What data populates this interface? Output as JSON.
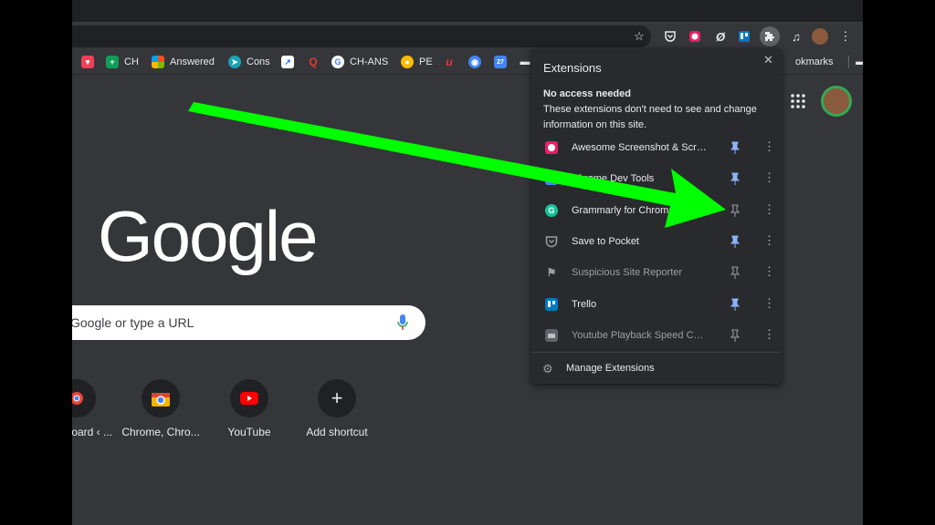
{
  "bookmarks": {
    "items": [
      {
        "label": "",
        "icon": "pocket-icon",
        "color": "#ef4056"
      },
      {
        "label": "CH",
        "icon": "sheets-icon",
        "color": "#0f9d58"
      },
      {
        "label": "Answered",
        "icon": "microsoft-icon",
        "color": "#f25022"
      },
      {
        "label": "Cons",
        "icon": "send-icon",
        "color": "#1aa3b8"
      },
      {
        "label": "",
        "icon": "bookmark-app-icon",
        "color": "#ffffff"
      },
      {
        "label": "",
        "icon": "q-icon",
        "color": "#e53935"
      },
      {
        "label": "CH-ANS",
        "icon": "google-icon",
        "color": "#ffffff"
      },
      {
        "label": "PE",
        "icon": "badge-icon",
        "color": "#fbbc04"
      },
      {
        "label": "",
        "icon": "u-icon",
        "color": "#e53935"
      },
      {
        "label": "",
        "icon": "chrome-icon",
        "color": "#4285f4"
      },
      {
        "label": "",
        "icon": "calendar-icon",
        "color": "#4285f4"
      },
      {
        "label": "",
        "icon": "folder-icon",
        "color": "#e8eaed"
      }
    ],
    "other_label": "okmarks"
  },
  "ntp": {
    "logo": "Google",
    "search_placeholder": "Google or type a URL",
    "shortcuts": [
      {
        "label": "oard ‹ ...",
        "icon": "chrome-shortcut-icon"
      },
      {
        "label": "Chrome, Chro...",
        "icon": "chrome-store-icon"
      },
      {
        "label": "YouTube",
        "icon": "youtube-icon"
      },
      {
        "label": "Add shortcut",
        "icon": "plus-icon"
      }
    ]
  },
  "extensions_popup": {
    "title": "Extensions",
    "heading": "No access needed",
    "description": "These extensions don't need to see and change information on this site.",
    "items": [
      {
        "name": "Awesome Screenshot & Scre...",
        "pinned": true,
        "dim": false,
        "icon": "awesome-screenshot-icon",
        "color": "#e91e63"
      },
      {
        "name": "Chrome Dev Tools",
        "pinned": true,
        "dim": false,
        "icon": "devtools-icon",
        "color": "#4285f4"
      },
      {
        "name": "Grammarly for Chrome",
        "pinned": false,
        "dim": false,
        "icon": "grammarly-icon",
        "color": "#15c39a"
      },
      {
        "name": "Save to Pocket",
        "pinned": true,
        "dim": false,
        "icon": "pocket-icon",
        "color": "#9aa0a6"
      },
      {
        "name": "Suspicious Site Reporter",
        "pinned": false,
        "dim": true,
        "icon": "flag-icon",
        "color": "#9aa0a6"
      },
      {
        "name": "Trello",
        "pinned": true,
        "dim": false,
        "icon": "trello-icon",
        "color": "#0079bf"
      },
      {
        "name": "Youtube Playback Speed Con...",
        "pinned": false,
        "dim": true,
        "icon": "youtube-speed-icon",
        "color": "#9aa0a6"
      }
    ],
    "manage_label": "Manage Extensions"
  },
  "colors": {
    "browser_bg": "#35363a",
    "popup_bg": "#292a2d",
    "pin_active": "#8ab4f8",
    "arrow": "#00ff00"
  }
}
